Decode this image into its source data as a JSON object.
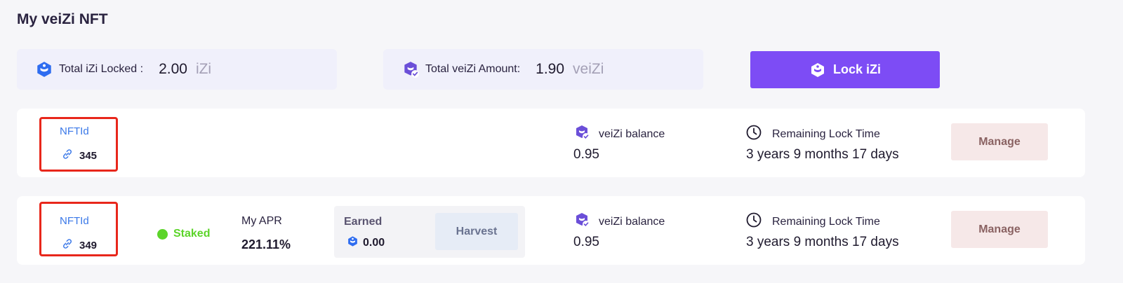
{
  "page": {
    "title": "My veiZi NFT"
  },
  "summary": {
    "total_locked": {
      "label": "Total iZi Locked :",
      "value": "2.00",
      "unit": "iZi",
      "icon": "izi-logo-icon"
    },
    "total_veizi": {
      "label": "Total veiZi Amount:",
      "value": "1.90",
      "unit": "veiZi",
      "icon": "veizi-logo-icon"
    }
  },
  "lock_button": {
    "label": "Lock iZi"
  },
  "nfts": [
    {
      "nft_label": "NFTId",
      "nft_id": "345",
      "balance_label": "veiZi balance",
      "balance": "0.95",
      "time_label": "Remaining Lock Time",
      "time": "3 years 9 months 17 days",
      "manage_label": "Manage"
    },
    {
      "nft_label": "NFTId",
      "nft_id": "349",
      "status": "Staked",
      "apr_label": "My APR",
      "apr": "221.11%",
      "earned_label": "Earned",
      "earned": "0.00",
      "harvest_label": "Harvest",
      "balance_label": "veiZi balance",
      "balance": "0.95",
      "time_label": "Remaining Lock Time",
      "time": "3 years 9 months 17 days",
      "manage_label": "Manage"
    }
  ],
  "colors": {
    "accent": "#7d4cf5",
    "link": "#3a78e8",
    "staked": "#5cd42a",
    "highlight_border": "#e8271b",
    "manage_bg": "#f6e8e8"
  }
}
